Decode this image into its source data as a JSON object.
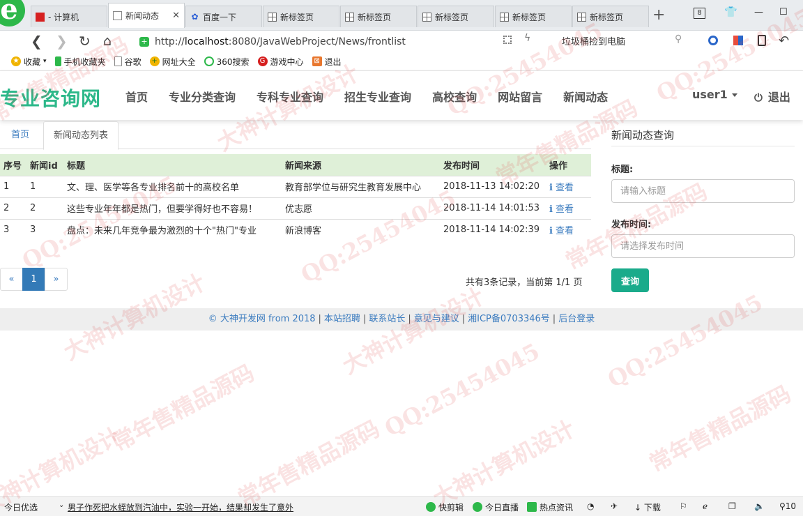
{
  "browser": {
    "tabs": [
      {
        "label": "- 计算机"
      },
      {
        "label": "新闻动态"
      },
      {
        "label": "百度一下"
      },
      {
        "label": "新标签页"
      },
      {
        "label": "新标签页"
      },
      {
        "label": "新标签页"
      },
      {
        "label": "新标签页"
      },
      {
        "label": "新标签页"
      }
    ],
    "tab_count": "8",
    "url_host": "localhost",
    "url_rest": ":8080/JavaWebProject/News/frontlist",
    "search_suggestion": "垃圾桶捡到电脑",
    "favorites": [
      "收藏",
      "手机收藏夹",
      "谷歌",
      "网址大全",
      "360搜索",
      "游戏中心",
      "退出"
    ]
  },
  "site": {
    "brand": "专业咨询网",
    "menu": [
      "首页",
      "专业分类查询",
      "专科专业查询",
      "招生专业查询",
      "高校查询",
      "网站留言",
      "新闻动态"
    ],
    "user": "user1",
    "logout": "退出"
  },
  "breadcrumb": {
    "home": "首页",
    "current": "新闻动态列表"
  },
  "table": {
    "headers": [
      "序号",
      "新闻id",
      "标题",
      "新闻来源",
      "发布时间",
      "操作"
    ],
    "view_label": "查看",
    "rows": [
      [
        "1",
        "1",
        "文、理、医学等各专业排名前十的高校名单",
        "教育部学位与研究生教育发展中心",
        "2018-11-13 14:02:20"
      ],
      [
        "2",
        "2",
        "这些专业年年都是热门，但要学得好也不容易！",
        "优志愿",
        "2018-11-14 14:01:53"
      ],
      [
        "3",
        "3",
        "盘点：未来几年竞争最为激烈的十个\"热门\"专业",
        "新浪博客",
        "2018-11-14 14:02:39"
      ]
    ]
  },
  "pagination": {
    "prev": "«",
    "current": "1",
    "next": "»",
    "info": "共有3条记录，当前第 1/1 页"
  },
  "sidebar": {
    "title": "新闻动态查询",
    "title_label": "标题:",
    "title_placeholder": "请输入标题",
    "date_label": "发布时间:",
    "date_placeholder": "请选择发布时间",
    "submit": "查询"
  },
  "footer": {
    "links": [
      "© 大神开发网 from 2018",
      "本站招聘",
      "联系站长",
      "意见与建议",
      "湘ICP备0703346号",
      "后台登录"
    ]
  },
  "statusbar": {
    "left": "今日优选",
    "news": "男子作死把水蛭放到汽油中，实验一开始，结果却发生了意外",
    "items": [
      "快剪辑",
      "今日直播",
      "热点资讯",
      "下载",
      "10"
    ]
  },
  "watermark": {
    "texts": [
      "QQ:25454045",
      "常年售精品源码",
      "大神计算机设计"
    ]
  }
}
